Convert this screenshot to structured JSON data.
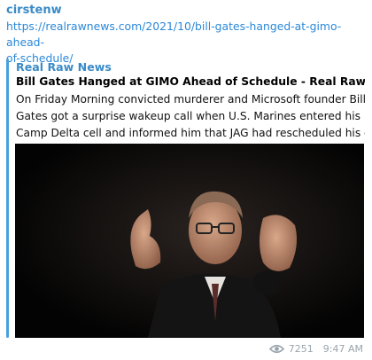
{
  "message": {
    "sender": "cirstenw",
    "url_line1": "https://realrawnews.com/2021/10/bill-gates-hanged-at-gimo-ahead-",
    "url_line2": "of-schedule/"
  },
  "preview": {
    "site_name": "Real Raw News",
    "title": "Bill Gates Hanged at GIMO Ahead of Schedule - Real Raw News",
    "description_lines": [
      "On Friday Morning convicted murderer and Microsoft founder Bill",
      "Gates got a surprise wakeup call when U.S. Marines entered his",
      "Camp Delta cell and informed him that JAG had rescheduled his e..."
    ]
  },
  "footer": {
    "views": "7251",
    "time": "9:47 AM"
  },
  "colors": {
    "sender": "#3a8bc8",
    "link": "#2b88d8",
    "accent_bar": "#4a9fde",
    "meta": "#9aa5ad"
  },
  "icons": [
    "eye-icon"
  ]
}
